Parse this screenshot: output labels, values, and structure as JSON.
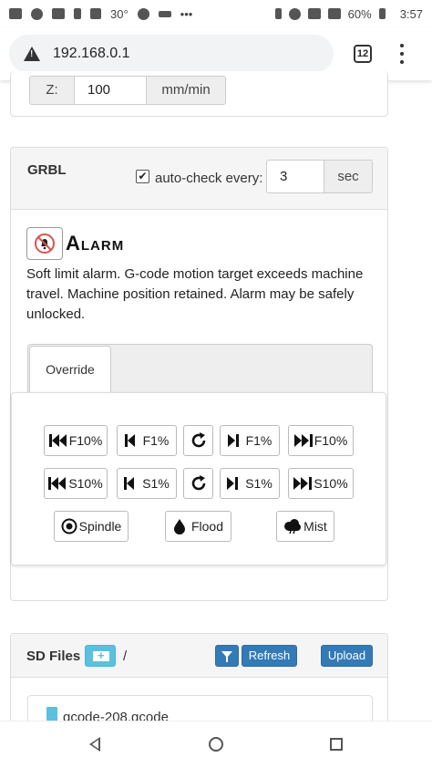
{
  "status_bar": {
    "temperature": "30°",
    "battery": "60%",
    "time": "3:57"
  },
  "browser": {
    "url": "192.168.0.1",
    "tab_count": "12"
  },
  "jog_speed": {
    "axis_label": "Z:",
    "value": "100",
    "unit": "mm/min"
  },
  "grbl": {
    "title": "GRBL",
    "autocheck_label": "auto-check every:",
    "autocheck_checked": true,
    "autocheck_value": "3",
    "autocheck_unit": "sec",
    "alarm_title": "Alarm",
    "alarm_message": "Soft limit alarm. G-code motion target exceeds machine travel. Machine position retained. Alarm may be safely unlocked.",
    "tab_override": "Override",
    "feed_buttons": [
      "F10%",
      "F1%",
      "F1%",
      "F10%"
    ],
    "speed_buttons": [
      "S10%",
      "S1%",
      "S1%",
      "S10%"
    ],
    "spindle_label": "Spindle",
    "flood_label": "Flood",
    "mist_label": "Mist"
  },
  "sd_files": {
    "title": "SD Files",
    "path": "/",
    "refresh_label": "Refresh",
    "upload_label": "Upload",
    "files": [
      "gcode-208.gcode"
    ]
  }
}
